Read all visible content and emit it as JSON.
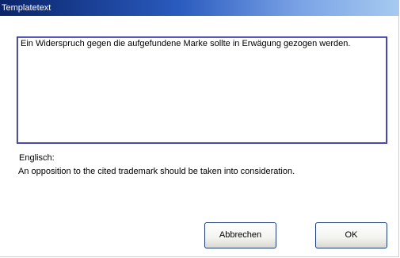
{
  "window": {
    "title": "Templatetext"
  },
  "template": {
    "text": "Ein Widerspruch gegen die aufgefundene Marke sollte in Erwägung gezogen werden."
  },
  "translation": {
    "language_label": "Englisch:",
    "text": "An opposition to the cited trademark should be taken into consideration."
  },
  "buttons": {
    "cancel_label": "Abbrechen",
    "ok_label": "OK"
  },
  "colors": {
    "titlebar_start": "#0a246a",
    "titlebar_end": "#a6caf0",
    "memo_border": "#1c1c8c",
    "button_border": "#1c3d7a"
  }
}
